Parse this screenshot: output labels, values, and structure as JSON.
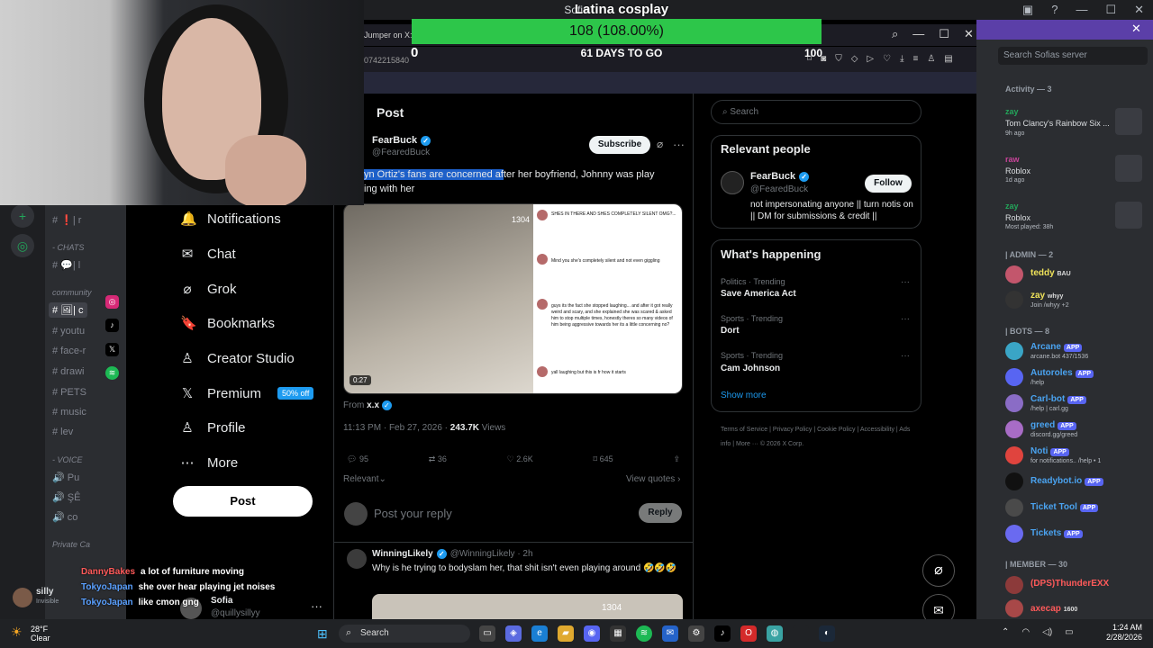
{
  "overlay": {
    "title": "Latina cosplay",
    "bar_text": "108 (108.00%)",
    "progress": 1.0,
    "min": "0",
    "max": "100",
    "days": "61 DAYS TO GO"
  },
  "discord": {
    "window_title": "Sofia",
    "search_placeholder": "Search Sofias server",
    "activity_header": "Activity — 3",
    "activities": [
      {
        "user": "zay",
        "title": "Tom Clancy's Rainbow Six ...",
        "sub": "9h ago"
      },
      {
        "user": "raw",
        "title": "Roblox",
        "sub": "1d ago"
      },
      {
        "user": "zay",
        "title": "Roblox",
        "sub": "Most played: 38h"
      }
    ],
    "admin_header": "| ADMIN — 2",
    "admins": [
      {
        "name": "teddy",
        "sub": "",
        "badge": "BAU",
        "color": "#f0e35a"
      },
      {
        "name": "zay",
        "sub": "Join /whyy +2",
        "badge": "whyy",
        "color": "#f0e35a"
      }
    ],
    "bots_header": "| BOTS — 8",
    "bots": [
      {
        "name": "Arcane",
        "sub": "arcane.bot 437/1536",
        "app": "APP",
        "color": "#4aa3f0"
      },
      {
        "name": "Autoroles",
        "sub": "/help",
        "app": "APP",
        "color": "#4aa3f0"
      },
      {
        "name": "Carl-bot",
        "sub": "/help | carl.gg",
        "app": "APP",
        "color": "#4aa3f0"
      },
      {
        "name": "greed",
        "sub": "discord.gg/greed",
        "app": "APP",
        "color": "#4aa3f0"
      },
      {
        "name": "Noti",
        "sub": "for notifications.. /help • 1",
        "app": "APP",
        "color": "#4aa3f0"
      },
      {
        "name": "Readybot.io",
        "sub": "",
        "app": "APP",
        "color": "#4aa3f0"
      },
      {
        "name": "Ticket Tool",
        "sub": "",
        "app": "APP",
        "color": "#4aa3f0"
      },
      {
        "name": "Tickets",
        "sub": "",
        "app": "APP",
        "color": "#4aa3f0"
      }
    ],
    "member_header": "| MEMBER — 30",
    "members": [
      {
        "name": "(DPS)ThunderEXX",
        "sub": "",
        "color": "#ff5a5a"
      },
      {
        "name": "axecap",
        "sub": "1600",
        "color": "#ff5a5a"
      }
    ],
    "channels": [
      "# ❗| r",
      "- CHATS",
      "# 💬| l",
      "community",
      "# 🖼| c",
      "# youtu",
      "# face-r",
      "# drawi",
      "# PETS",
      "# music",
      "# lev",
      "- VOICE",
      "🔊 Pu",
      "🔊 ŞÊ",
      "🔊 co",
      "Private Ca"
    ],
    "user": {
      "name": "silly",
      "status": "Invisible"
    }
  },
  "chat": [
    {
      "user": "DannyBakes",
      "msg": "a lot of furniture moving"
    },
    {
      "user": "TokyoJapan",
      "msg": "she over hear playing jet noises"
    },
    {
      "user": "TokyoJapan",
      "msg": "like cmon gng"
    }
  ],
  "browser": {
    "tab_text": "Jumper on X:",
    "url_text": "0742215840"
  },
  "x": {
    "nav": [
      {
        "icon": "bell-icon",
        "glyph": "🔔",
        "label": "Notifications"
      },
      {
        "icon": "mail-icon",
        "glyph": "✉",
        "label": "Chat"
      },
      {
        "icon": "grok-icon",
        "glyph": "⌀",
        "label": "Grok"
      },
      {
        "icon": "bookmark-icon",
        "glyph": "🔖",
        "label": "Bookmarks"
      },
      {
        "icon": "lightbulb-icon",
        "glyph": "♙",
        "label": "Creator Studio"
      },
      {
        "icon": "x-logo-icon",
        "glyph": "𝕏",
        "label": "Premium"
      },
      {
        "icon": "person-icon",
        "glyph": "♙",
        "label": "Profile"
      },
      {
        "icon": "more-circle-icon",
        "glyph": "⋯",
        "label": "More"
      }
    ],
    "premium_badge": "50% off",
    "post_button": "Post",
    "me": {
      "name": "Sofia",
      "handle": "@quillysillyy"
    },
    "header": "Post",
    "tweet": {
      "name": "FearBuck",
      "handle": "@FearedBuck",
      "subscribe": "Subscribe",
      "text_highlight": "yn Ortiz's fans are concerned af",
      "text_rest": "ter her boyfriend, Johnny was play",
      "text_line2": "ing with her",
      "duration": "0:27",
      "watermark": "1304",
      "from_label": "From",
      "from_user": "x.x",
      "time": "11:13 PM · Feb 27, 2026 · ",
      "views": "243.7K",
      "views_label": " Views",
      "replies": "95",
      "reposts": "36",
      "likes": "2.6K",
      "bookmarks": "645",
      "comments": [
        {
          "text": "SHES IN THERE AND SHES COMPLETELY SILENT OMG?..."
        },
        {
          "text": "Mind you she's completely silent and not even giggling"
        },
        {
          "text": "guys its the fact she stopped laughing... and after it got really weird and scary, and she explained she was scared & asked him to stop multiple times, honestly theres so many videos of him being aggressive towards her its a little concerning no?"
        },
        {
          "text": "yall laughing but this is fr how it starts"
        }
      ]
    },
    "relevant_label": "Relevant",
    "view_quotes": "View quotes",
    "reply_placeholder": "Post your reply",
    "reply_button": "Reply",
    "reply": {
      "name": "WinningLikely",
      "handle": "@WinningLikely · 2h",
      "text": "Why is he trying to bodyslam her, that shit isn't even playing around 🤣🤣🤣",
      "watermark": "1304"
    },
    "search_placeholder": "Search",
    "relevant": {
      "title": "Relevant people",
      "name": "FearBuck",
      "handle": "@FearedBuck",
      "follow": "Follow",
      "bio": "not impersonating anyone || turn notis on || DM for submissions & credit ||"
    },
    "happening": {
      "title": "What's happening",
      "trends": [
        {
          "cat": "Politics · Trending",
          "name": "Save America Act"
        },
        {
          "cat": "Sports · Trending",
          "name": "Dort"
        },
        {
          "cat": "Sports · Trending",
          "name": "Cam Johnson"
        }
      ],
      "show_more": "Show more"
    },
    "footer": "Terms of Service | Privacy Policy | Cookie Policy | Accessibility | Ads info | More ··· © 2026 X Corp."
  },
  "taskbar": {
    "temp": "28°F",
    "weather": "Clear",
    "search": "Search",
    "time": "1:24 AM",
    "date": "2/28/2026"
  }
}
